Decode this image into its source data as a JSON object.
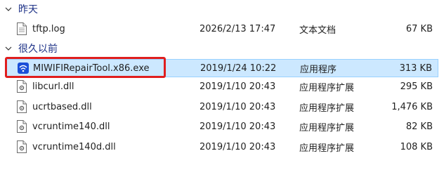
{
  "groups": [
    {
      "title": "昨天",
      "files": [
        {
          "name": "tftp.log",
          "date": "2026/2/13 17:47",
          "type": "文本文档",
          "size": "67 KB",
          "icon": "text-file-icon"
        }
      ]
    },
    {
      "title": "很久以前",
      "files": [
        {
          "name": "MIWIFIRepairTool.x86.exe",
          "date": "2019/1/24 10:22",
          "type": "应用程序",
          "size": "313 KB",
          "icon": "wifi-app-icon"
        },
        {
          "name": "libcurl.dll",
          "date": "2019/1/10 20:43",
          "type": "应用程序扩展",
          "size": "295 KB",
          "icon": "dll-file-icon"
        },
        {
          "name": "ucrtbased.dll",
          "date": "2019/1/10 20:43",
          "type": "应用程序扩展",
          "size": "1,476 KB",
          "icon": "dll-file-icon"
        },
        {
          "name": "vcruntime140.dll",
          "date": "2019/1/10 20:43",
          "type": "应用程序扩展",
          "size": "82 KB",
          "icon": "dll-file-icon"
        },
        {
          "name": "vcruntime140d.dll",
          "date": "2019/1/10 20:43",
          "type": "应用程序扩展",
          "size": "108 KB",
          "icon": "dll-file-icon"
        }
      ]
    }
  ],
  "colors": {
    "group_header": "#1e3287",
    "selection_bg": "#cce8ff",
    "selection_border": "#99d1ff",
    "highlight": "#e01e1e"
  }
}
